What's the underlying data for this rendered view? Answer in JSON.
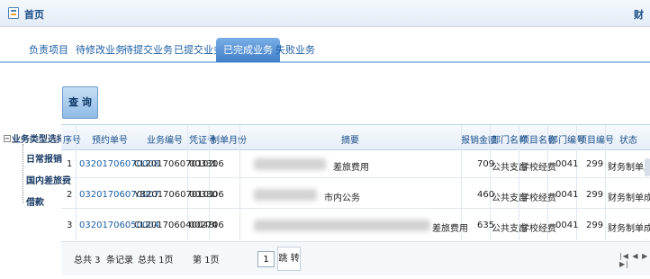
{
  "titlebar": {
    "title": "首页",
    "right_text": "财"
  },
  "tabs": [
    {
      "label": "负责项目",
      "active": false
    },
    {
      "label": "待修改业务",
      "active": false
    },
    {
      "label": "待提交业务",
      "active": false
    },
    {
      "label": "已提交业务",
      "active": false
    },
    {
      "label": "已完成业务",
      "active": true
    },
    {
      "label": "失败业务",
      "active": false
    }
  ],
  "query_button": "查 询",
  "tree": {
    "root": "业务类型选择",
    "items": [
      "日常报销",
      "国内差旅费",
      "借款"
    ]
  },
  "table": {
    "headers": [
      "序号",
      "预约单号",
      "业务编号",
      "凭证号",
      "制单月份",
      "摘要",
      "报销金额",
      "部门名称",
      "项目名称",
      "部门编号",
      "项目编号",
      "状态"
    ],
    "rows": [
      [
        "1",
        "03201706070008",
        "CL201706070102",
        "00331",
        "06",
        "差旅费用",
        "709",
        "公共支出",
        "学校经费",
        "0041",
        "299",
        "财务制单成功"
      ],
      [
        "2",
        "03201706070007",
        "YB201706070101",
        "00330",
        "06",
        "市内公务",
        "460",
        "公共支出",
        "学校经费",
        "0041",
        "299",
        "财务制单成功"
      ],
      [
        "3",
        "03201706050004",
        "CL201706040048",
        "00274",
        "06",
        "差旅费用",
        "635",
        "公共支出",
        "学校经费",
        "0041",
        "299",
        "财务制单成功"
      ]
    ]
  },
  "pager": {
    "total": "总共 3",
    "records_label": "条记录",
    "pages": "总共 1页",
    "current": "第 1页",
    "input_value": "1",
    "jump_label": "跳 转"
  },
  "colors": {
    "accent": "#3f7fc8",
    "link": "#1a5ea3",
    "header_text": "#1a4f8a"
  }
}
